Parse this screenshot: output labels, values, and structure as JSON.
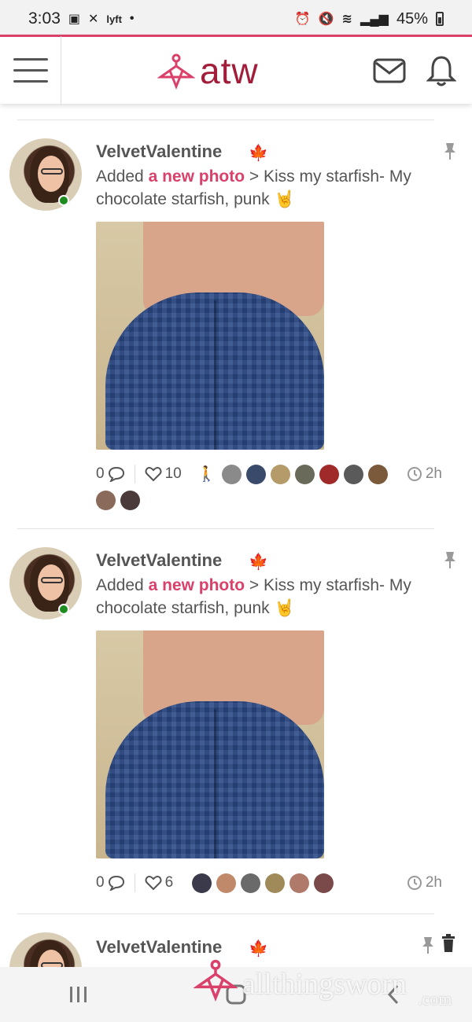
{
  "status_bar": {
    "time": "3:03",
    "left_icons": [
      "calendar-icon",
      "x-icon",
      "lyft-icon"
    ],
    "right_icons": [
      "alarm-icon",
      "mute-icon",
      "wifi-icon",
      "signal-icon"
    ],
    "battery": "45%"
  },
  "header": {
    "logo_text": "atw",
    "accent_color": "#d9416a",
    "logo_color": "#a11d3a"
  },
  "posts": [
    {
      "username": "VelvetValentine",
      "flag": "🍁",
      "activity_prefix": "Added ",
      "activity_link": "a new photo",
      "activity_suffix": " > Kiss my starfish- My chocolate starfish, punk 🤘",
      "comments": "0",
      "likes": "10",
      "time": "2h"
    },
    {
      "username": "VelvetValentine",
      "flag": "🍁",
      "activity_prefix": "Added ",
      "activity_link": "a new photo",
      "activity_suffix": " > Kiss my starfish- My chocolate starfish, punk 🤘",
      "comments": "0",
      "likes": "6",
      "time": "2h"
    },
    {
      "username": "VelvetValentine",
      "flag": "🍁"
    }
  ],
  "watermark": {
    "text": "allthingsworn",
    "sub": ".com"
  }
}
